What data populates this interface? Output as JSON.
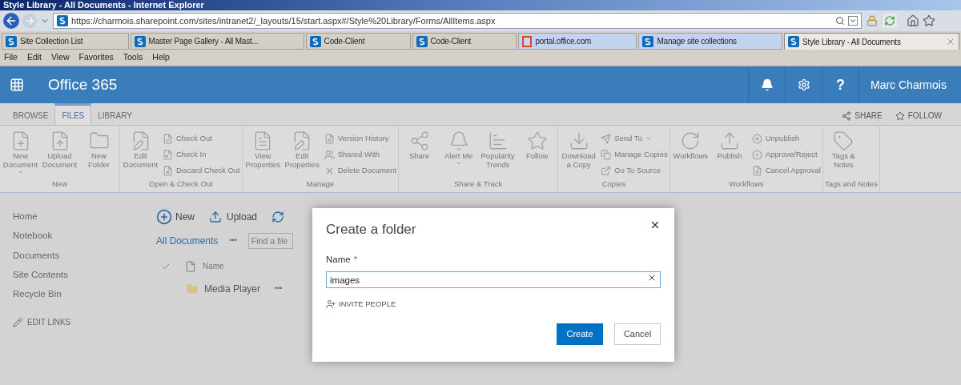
{
  "window": {
    "title": "Style Library - All Documents - Internet Explorer"
  },
  "browser": {
    "address": "https://charmois.sharepoint.com/sites/intranet2/_layouts/15/start.aspx#/Style%20Library/Forms/AllItems.aspx",
    "tabs": [
      {
        "label": "Site Collection List",
        "kind": "sharepoint",
        "color": "#d4d0c8",
        "selected": false
      },
      {
        "label": "Master Page Gallery - All Mast...",
        "kind": "sharepoint",
        "color": "#d4d0c8",
        "selected": false
      },
      {
        "label": "Code-Client",
        "kind": "sharepoint",
        "color": "#d4d0c8",
        "selected": false
      },
      {
        "label": "Code-Client",
        "kind": "sharepoint",
        "color": "#d4d0c8",
        "selected": false
      },
      {
        "label": "portal.office.com",
        "kind": "office",
        "color": "#c3d3f2",
        "selected": false
      },
      {
        "label": "Manage site collections",
        "kind": "sharepoint",
        "color": "#c3d3f2",
        "selected": false
      },
      {
        "label": "Style Library - All Documents",
        "kind": "sharepoint",
        "color": "#ece9e4",
        "selected": true
      }
    ],
    "menu": [
      "File",
      "Edit",
      "View",
      "Favorites",
      "Tools",
      "Help"
    ]
  },
  "suite_bar": {
    "title": "Office 365",
    "help": "?",
    "user": "Marc Charmois"
  },
  "ribbon": {
    "tabs": [
      {
        "label": "BROWSE",
        "selected": false
      },
      {
        "label": "FILES",
        "selected": true
      },
      {
        "label": "LIBRARY",
        "selected": false
      }
    ],
    "actions": [
      "SHARE",
      "FOLLOW"
    ],
    "groups": [
      {
        "label": "New",
        "items": [
          {
            "label": "New Document",
            "kind": "large",
            "dropdown": true
          },
          {
            "label": "Upload Document",
            "kind": "large",
            "dropdown": false
          },
          {
            "label": "New Folder",
            "kind": "large",
            "dropdown": false
          }
        ]
      },
      {
        "label": "Open & Check Out",
        "items": [
          {
            "label": "Edit Document",
            "kind": "large",
            "dropdown": false
          },
          {
            "label": "Check Out",
            "kind": "small",
            "dropdown": false
          },
          {
            "label": "Check In",
            "kind": "small",
            "dropdown": false
          },
          {
            "label": "Discard Check Out",
            "kind": "small",
            "dropdown": false
          }
        ]
      },
      {
        "label": "Manage",
        "items": [
          {
            "label": "View Properties",
            "kind": "large",
            "dropdown": false
          },
          {
            "label": "Edit Properties",
            "kind": "large",
            "dropdown": false
          },
          {
            "label": "Version History",
            "kind": "small",
            "dropdown": false
          },
          {
            "label": "Shared With",
            "kind": "small",
            "dropdown": false
          },
          {
            "label": "Delete Document",
            "kind": "small",
            "dropdown": false
          }
        ]
      },
      {
        "label": "Share & Track",
        "items": [
          {
            "label": "Share",
            "kind": "large",
            "dropdown": false
          },
          {
            "label": "Alert Me",
            "kind": "large",
            "dropdown": true
          },
          {
            "label": "Popularity Trends",
            "kind": "large",
            "dropdown": false
          },
          {
            "label": "Follow",
            "kind": "large",
            "dropdown": false
          }
        ]
      },
      {
        "label": "Copies",
        "items": [
          {
            "label": "Download a Copy",
            "kind": "large",
            "dropdown": false
          },
          {
            "label": "Send To",
            "kind": "small",
            "dropdown": true
          },
          {
            "label": "Manage Copies",
            "kind": "small",
            "dropdown": false
          },
          {
            "label": "Go To Source",
            "kind": "small",
            "dropdown": false
          }
        ]
      },
      {
        "label": "Workflows",
        "items": [
          {
            "label": "Workflows",
            "kind": "large",
            "dropdown": false
          },
          {
            "label": "Publish",
            "kind": "large",
            "dropdown": false
          },
          {
            "label": "Unpublish",
            "kind": "small",
            "dropdown": false
          },
          {
            "label": "Approve/Reject",
            "kind": "small",
            "dropdown": false
          },
          {
            "label": "Cancel Approval",
            "kind": "small",
            "dropdown": false
          }
        ]
      },
      {
        "label": "Tags and Notes",
        "items": [
          {
            "label": "Tags & Notes",
            "kind": "large",
            "dropdown": false
          }
        ]
      }
    ]
  },
  "left_nav": {
    "items": [
      "Home",
      "Notebook",
      "Documents",
      "Site Contents",
      "Recycle Bin"
    ],
    "edit_links": "EDIT LINKS"
  },
  "toolbar": {
    "new": "New",
    "upload": "Upload"
  },
  "view": {
    "name": "All Documents",
    "more": "•••",
    "search": {
      "placeholder": "Find a file"
    }
  },
  "list": {
    "columns": [
      "Name"
    ],
    "rows": [
      {
        "name": "Media Player",
        "more": "•••"
      }
    ]
  },
  "dialog": {
    "title": "Create a folder",
    "field": {
      "label": "Name",
      "required_mark": "*",
      "value": "images"
    },
    "invite": "INVITE PEOPLE",
    "buttons": [
      {
        "label": "Create",
        "kind": "primary"
      },
      {
        "label": "Cancel",
        "kind": "secondary"
      }
    ]
  }
}
